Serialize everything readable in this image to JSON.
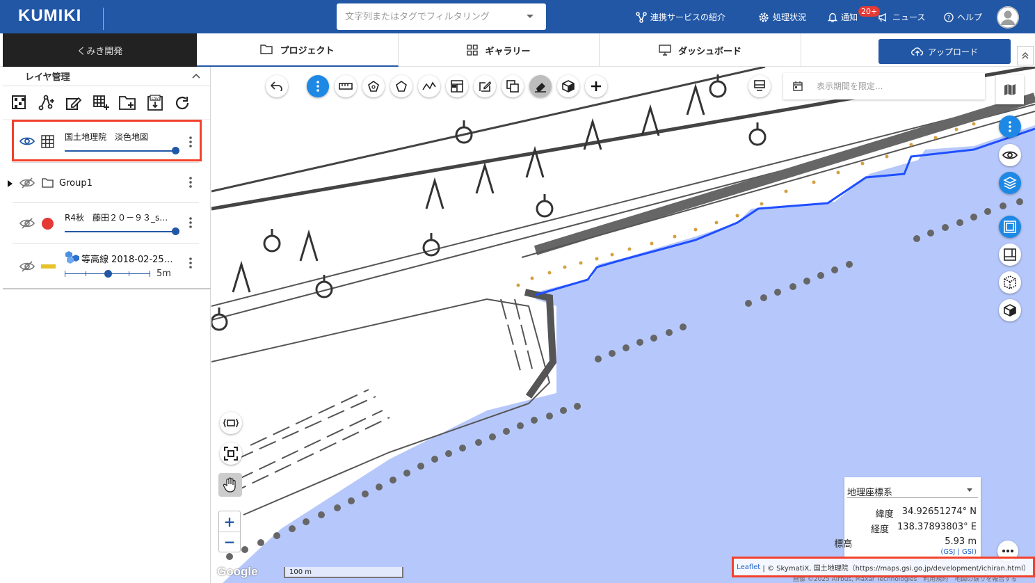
{
  "header": {
    "logo": "KUMIKI",
    "search_placeholder": "文字列またはタグでフィルタリング",
    "nav": {
      "integrations": "連携サービスの紹介",
      "processing": "処理状況",
      "notifications": "通知",
      "notifications_badge": "20+",
      "news": "ニュース",
      "help": "ヘルプ"
    }
  },
  "subbar": {
    "org": "くみき開発",
    "tabs": [
      "プロジェクト",
      "ギャラリー",
      "ダッシュボード"
    ],
    "upload": "アップロード"
  },
  "panel": {
    "title": "レイヤ管理",
    "layers": [
      {
        "name": "国土地理院　淡色地図",
        "visible": true,
        "opacity": 1.0
      },
      {
        "name": "Group1",
        "visible": false
      },
      {
        "name": "R4秋　藤田２０－９３_s…",
        "visible": false,
        "opacity": 1.0,
        "color": "#e53935"
      },
      {
        "name": "等高線 2018-02-25…",
        "visible": false,
        "interval_label": "5m",
        "color": "#e8c22b"
      }
    ]
  },
  "map": {
    "date_placeholder": "表示期間を限定...",
    "coords": {
      "system": "地理座標系",
      "lat_label": "緯度",
      "lat": "34.92651274° N",
      "lng_label": "経度",
      "lng": "138.37893803° E",
      "elev_label": "標高",
      "elev": "5.93 m",
      "links": "(GSJ | GSI)"
    },
    "scale": "100 m",
    "zoom_in": "+",
    "zoom_out": "−",
    "google": "Google",
    "attribution_link": "Leaflet",
    "attribution_text": "| © SkymatiX, 国土地理院（https://maps.gsi.go.jp/development/ichiran.html）",
    "google_credit": "画像 ©2025 Airbus, Maxar Technologies　利用規約　地図の誤りを報告する",
    "colors": {
      "water": "#b6c8fb",
      "shore": "#1f4fff",
      "land": "#ffffff"
    }
  }
}
